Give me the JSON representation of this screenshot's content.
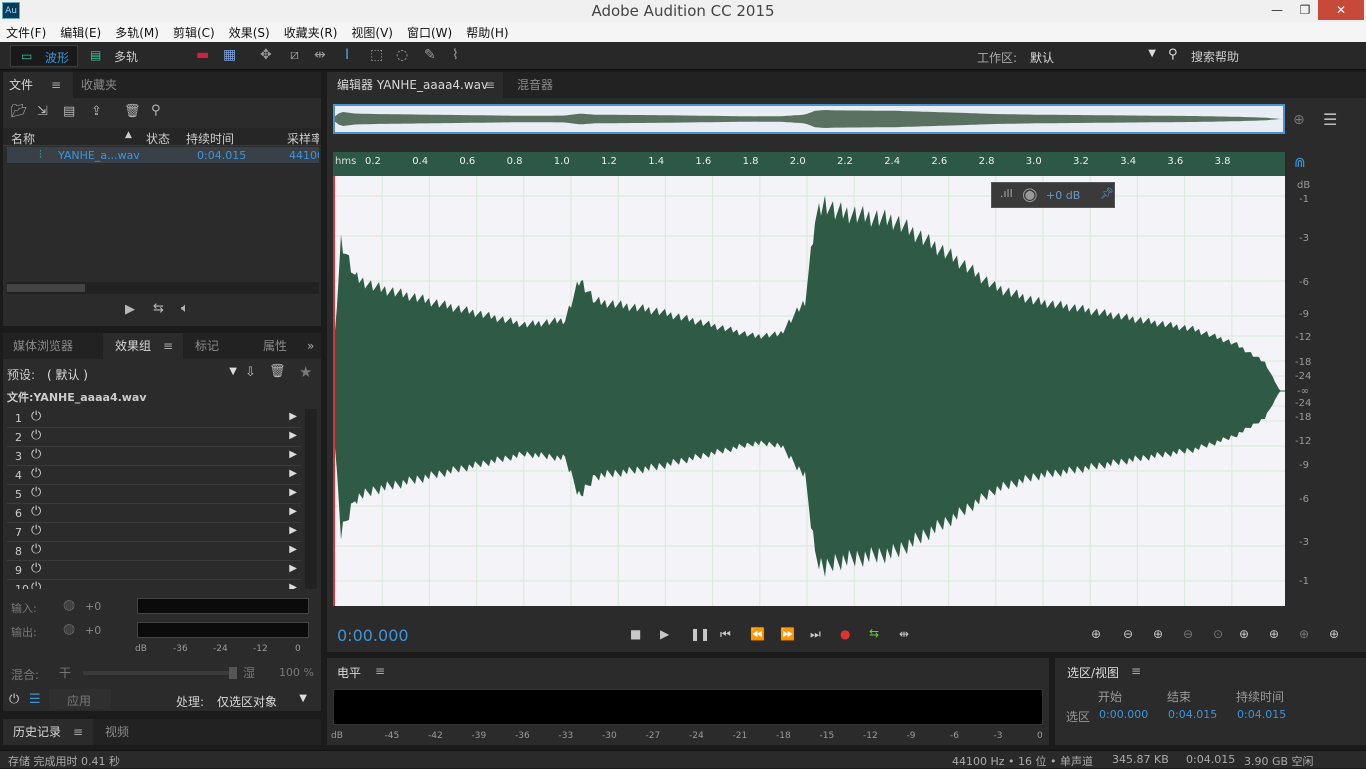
{
  "titlebar": {
    "app_icon": "Au",
    "title": "Adobe Audition CC 2015",
    "min": "—",
    "max": "❐",
    "close": "✕"
  },
  "menu": [
    "文件(F)",
    "编辑(E)",
    "多轨(M)",
    "剪辑(C)",
    "效果(S)",
    "收藏夹(R)",
    "视图(V)",
    "窗口(W)",
    "帮助(H)"
  ],
  "toolbar": {
    "waveform": "波形",
    "multitrack": "多轨",
    "workspace_label": "工作区:",
    "workspace_value": "默认",
    "search_help": "搜索帮助"
  },
  "files_panel": {
    "tabs": [
      "文件",
      "收藏夹"
    ],
    "columns": [
      "名称",
      "状态",
      "持续时间",
      "采样率"
    ],
    "rows": [
      {
        "name": "YANHE_a...wav",
        "duration": "0:04.015",
        "rate": "44100"
      }
    ]
  },
  "effects_panel": {
    "tabs": [
      "媒体浏览器",
      "效果组",
      "标记",
      "属性"
    ],
    "preset_label": "预设:",
    "preset_value": "( 默认 )",
    "file_label": "文件:YANHE_aaaa4.wav",
    "slots": [
      "1",
      "2",
      "3",
      "4",
      "5",
      "6",
      "7",
      "8",
      "9",
      "10"
    ],
    "input_label": "输入:",
    "output_label": "输出:",
    "input_gain": "+0",
    "output_gain": "+0",
    "scale": [
      "dB",
      "-36",
      "-24",
      "-12",
      "0"
    ],
    "mix_label": "混合:",
    "mix_dry": "干",
    "mix_wet": "湿",
    "mix_pct": "100 %",
    "apply": "应用",
    "process_label": "处理:",
    "process_value": "仅选区对象"
  },
  "history_panel": {
    "tabs": [
      "历史记录",
      "视频"
    ]
  },
  "editor": {
    "tab": "编辑器 YANHE_aaaa4.wav",
    "mixer_tab": "混音器",
    "ruler_unit": "hms",
    "ruler": [
      "0.2",
      "0.4",
      "0.6",
      "0.8",
      "1.0",
      "1.2",
      "1.4",
      "1.6",
      "1.8",
      "2.0",
      "2.2",
      "2.4",
      "2.6",
      "2.8",
      "3.0",
      "3.2",
      "3.4",
      "3.6",
      "3.8"
    ],
    "db_scale": [
      "dB",
      "-1",
      "-3",
      "-6",
      "-9",
      "-12",
      "-18",
      "-24",
      "-∞",
      "-24",
      "-18",
      "-12",
      "-9",
      "-6",
      "-3",
      "-1"
    ],
    "hud_gain": "+0 dB",
    "time": "0:00.000",
    "waveform_color": "#2f5a45"
  },
  "level_panel": {
    "title": "电平",
    "scale": [
      "dB",
      "-45",
      "-42",
      "-39",
      "-36",
      "-33",
      "-30",
      "-27",
      "-24",
      "-21",
      "-18",
      "-15",
      "-12",
      "-9",
      "-6",
      "-3",
      "0"
    ]
  },
  "selection_panel": {
    "title": "选区/视图",
    "headers": [
      "开始",
      "结束",
      "持续时间"
    ],
    "row_label": "选区",
    "start": "0:00.000",
    "end": "0:04.015",
    "duration": "0:04.015"
  },
  "statusbar": {
    "left": "存储 完成用时 0.41 秒",
    "format": "44100 Hz • 16 位 • 单声道",
    "size": "345.87 KB",
    "duration": "0:04.015",
    "free": "3.90 GB 空闲"
  }
}
